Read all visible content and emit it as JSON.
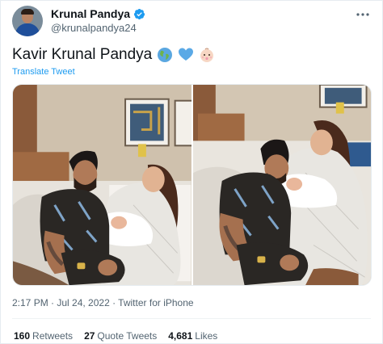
{
  "author": {
    "display_name": "Krunal Pandya",
    "handle": "@krunalpandya24"
  },
  "tweet": {
    "text": "Kavir Krunal Pandya",
    "emojis": [
      "globe-icon",
      "blue-heart-icon",
      "baby-face-icon"
    ],
    "translate_label": "Translate Tweet"
  },
  "media": {
    "count": 2
  },
  "meta": {
    "timestamp": "2:17 PM · Jul 24, 2022 · Twitter for iPhone"
  },
  "stats": {
    "retweets_count": "160",
    "retweets_label": "Retweets",
    "quotes_count": "27",
    "quotes_label": "Quote Tweets",
    "likes_count": "4,681",
    "likes_label": "Likes"
  },
  "colors": {
    "accent": "#1d9bf0",
    "text": "#0f1419",
    "muted": "#536471"
  }
}
